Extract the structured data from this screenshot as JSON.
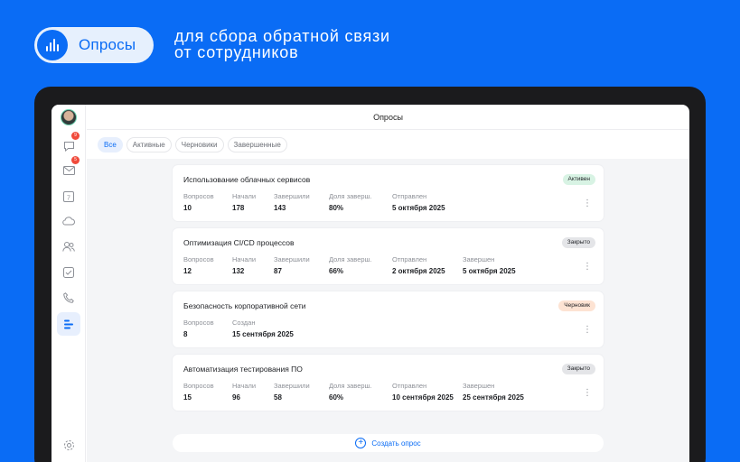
{
  "hero": {
    "pill_label": "Опросы",
    "tagline_line1": "для сбора обратной связи",
    "tagline_line2": "от сотрудников",
    "icon": "bar-chart-icon",
    "accent": "#0a6cf5"
  },
  "sidebar": {
    "items": [
      {
        "icon": "avatar"
      },
      {
        "icon": "chat-icon",
        "badge": "9"
      },
      {
        "icon": "mail-icon",
        "badge": "5"
      },
      {
        "icon": "calendar-icon",
        "label": "7"
      },
      {
        "icon": "cloud-icon"
      },
      {
        "icon": "contacts-icon"
      },
      {
        "icon": "tasks-icon"
      },
      {
        "icon": "phone-icon"
      },
      {
        "icon": "surveys-icon",
        "active": true
      },
      {
        "icon": "settings-icon"
      }
    ]
  },
  "header": {
    "title": "Опросы"
  },
  "filters": {
    "all": "Все",
    "active": "Активные",
    "drafts": "Черновики",
    "completed": "Завершенные"
  },
  "cards": [
    {
      "title": "Использование облачных сервисов",
      "status": "Активен",
      "stats": [
        {
          "label": "Вопросов",
          "value": "10"
        },
        {
          "label": "Начали",
          "value": "178"
        },
        {
          "label": "Завершили",
          "value": "143"
        },
        {
          "label": "Доля заверш.",
          "value": "80%"
        },
        {
          "label": "Отправлен",
          "value": "5 октября 2025"
        }
      ]
    },
    {
      "title": "Оптимизация CI/CD процессов",
      "status": "Закрыто",
      "stats": [
        {
          "label": "Вопросов",
          "value": "12"
        },
        {
          "label": "Начали",
          "value": "132"
        },
        {
          "label": "Завершили",
          "value": "87"
        },
        {
          "label": "Доля заверш.",
          "value": "66%"
        },
        {
          "label": "Отправлен",
          "value": "2 октября 2025"
        },
        {
          "label": "Завершен",
          "value": "5 октября 2025"
        }
      ]
    },
    {
      "title": "Безопасность корпоративной сети",
      "status": "Черновик",
      "stats": [
        {
          "label": "Вопросов",
          "value": "8"
        },
        {
          "label": "Создан",
          "value": "15 сентября 2025"
        }
      ]
    },
    {
      "title": "Автоматизация тестирования ПО",
      "status": "Закрыто",
      "stats": [
        {
          "label": "Вопросов",
          "value": "15"
        },
        {
          "label": "Начали",
          "value": "96"
        },
        {
          "label": "Завершили",
          "value": "58"
        },
        {
          "label": "Доля заверш.",
          "value": "60%"
        },
        {
          "label": "Отправлен",
          "value": "10 сентября 2025"
        },
        {
          "label": "Завершен",
          "value": "25 сентября 2025"
        }
      ]
    }
  ],
  "create_button": {
    "label": "Создать опрос"
  },
  "colors": {
    "status_active": "#d8f3e4",
    "status_closed": "#e4e5e8",
    "status_draft": "#fde3d3"
  }
}
